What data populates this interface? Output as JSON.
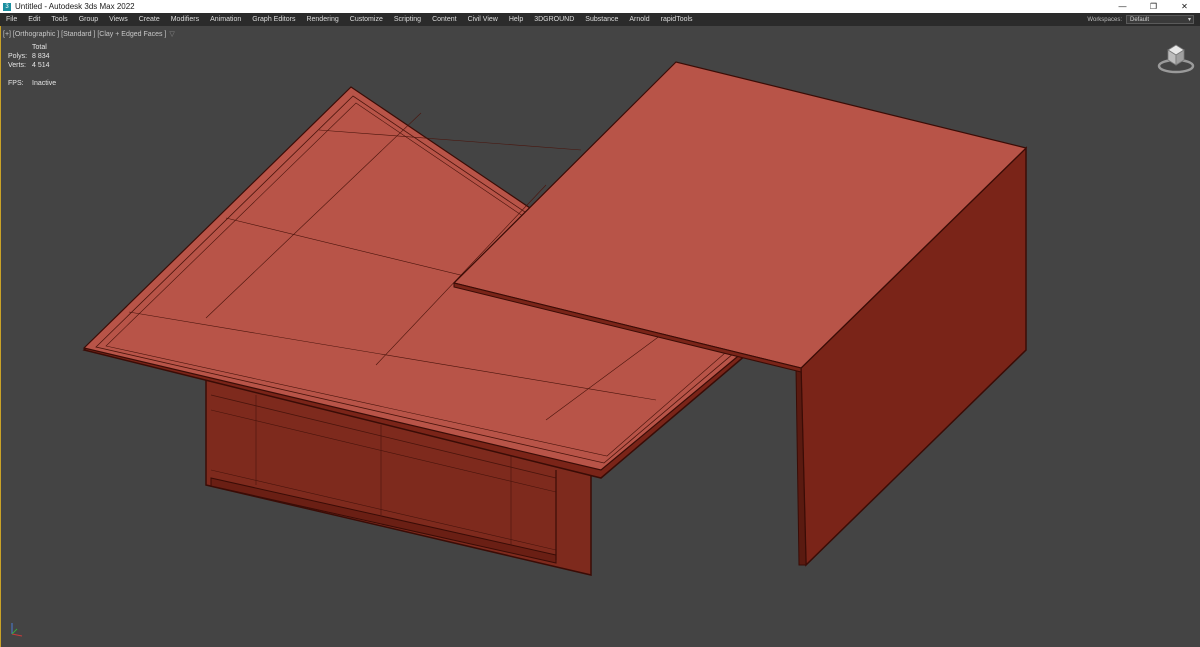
{
  "window": {
    "title": "Untitled - Autodesk 3ds Max 2022",
    "app_icon": "3ds-max-icon",
    "controls": {
      "minimize": "—",
      "restore": "❐",
      "close": "✕"
    }
  },
  "menubar": {
    "items": [
      "File",
      "Edit",
      "Tools",
      "Group",
      "Views",
      "Create",
      "Modifiers",
      "Animation",
      "Graph Editors",
      "Rendering",
      "Customize",
      "Scripting",
      "Content",
      "Civil View",
      "Help",
      "3DGROUND",
      "Substance",
      "Arnold",
      "rapidTools"
    ],
    "workspaces_label": "Workspaces:",
    "workspaces_value": "Default"
  },
  "viewport": {
    "label": "[+] [Orthographic ] [Standard ] [Clay + Edged Faces ]",
    "filter_icon": "filter-icon",
    "stats": {
      "header": "Total",
      "polys_label": "Polys:",
      "polys_value": "8 834",
      "verts_label": "Verts:",
      "verts_value": "4 514",
      "fps_label": "FPS:",
      "fps_value": "Inactive"
    },
    "colors": {
      "background": "#444444",
      "clay_top": "#b85448",
      "clay_side": "#7a2418",
      "edge": "#3a0c06",
      "border_active": "#c9a227"
    }
  }
}
